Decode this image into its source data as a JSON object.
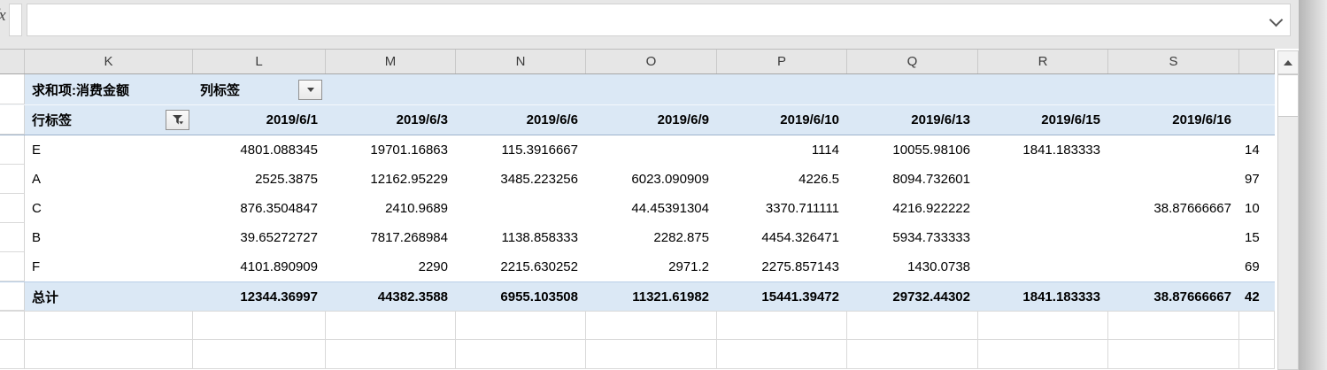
{
  "sheet": {
    "column_letters": [
      "K",
      "L",
      "M",
      "N",
      "O",
      "P",
      "Q",
      "R",
      "S"
    ],
    "pivot": {
      "title": "求和项:消费金额",
      "col_label": "列标签",
      "row_label": "行标签",
      "dates": [
        "2019/6/1",
        "2019/6/3",
        "2019/6/6",
        "2019/6/9",
        "2019/6/10",
        "2019/6/13",
        "2019/6/15",
        "2019/6/16"
      ],
      "rows": [
        {
          "label": "E",
          "values": [
            "4801.088345",
            "19701.16863",
            "115.3916667",
            "",
            "1114",
            "10055.98106",
            "1841.183333",
            ""
          ],
          "partial": "14"
        },
        {
          "label": "A",
          "values": [
            "2525.3875",
            "12162.95229",
            "3485.223256",
            "6023.090909",
            "4226.5",
            "8094.732601",
            "",
            ""
          ],
          "partial": "97"
        },
        {
          "label": "C",
          "values": [
            "876.3504847",
            "2410.9689",
            "",
            "44.45391304",
            "3370.711111",
            "4216.922222",
            "",
            "38.87666667"
          ],
          "partial": "10"
        },
        {
          "label": "B",
          "values": [
            "39.65272727",
            "7817.268984",
            "1138.858333",
            "2282.875",
            "4454.326471",
            "5934.733333",
            "",
            ""
          ],
          "partial": "15"
        },
        {
          "label": "F",
          "values": [
            "4101.890909",
            "2290",
            "2215.630252",
            "2971.2",
            "2275.857143",
            "1430.0738",
            "",
            ""
          ],
          "partial": "69"
        }
      ],
      "total": {
        "label": "总计",
        "values": [
          "12344.36997",
          "44382.3588",
          "6955.103508",
          "11321.61982",
          "15441.39472",
          "29732.44302",
          "1841.183333",
          "38.87666667"
        ],
        "partial": "42"
      }
    },
    "icons": {
      "fx": "fx",
      "formula_chevron": "chevron-down",
      "col_label_dropdown": "dropdown-arrow",
      "row_label_filter": "filter-funnel",
      "scrollbar_up": "arrow-up"
    },
    "colors": {
      "pivot_fill": "#dbe8f5",
      "header_fill": "#e6e6e6",
      "gridline": "#d9d9d9",
      "pivot_border": "#9db3cc"
    }
  }
}
